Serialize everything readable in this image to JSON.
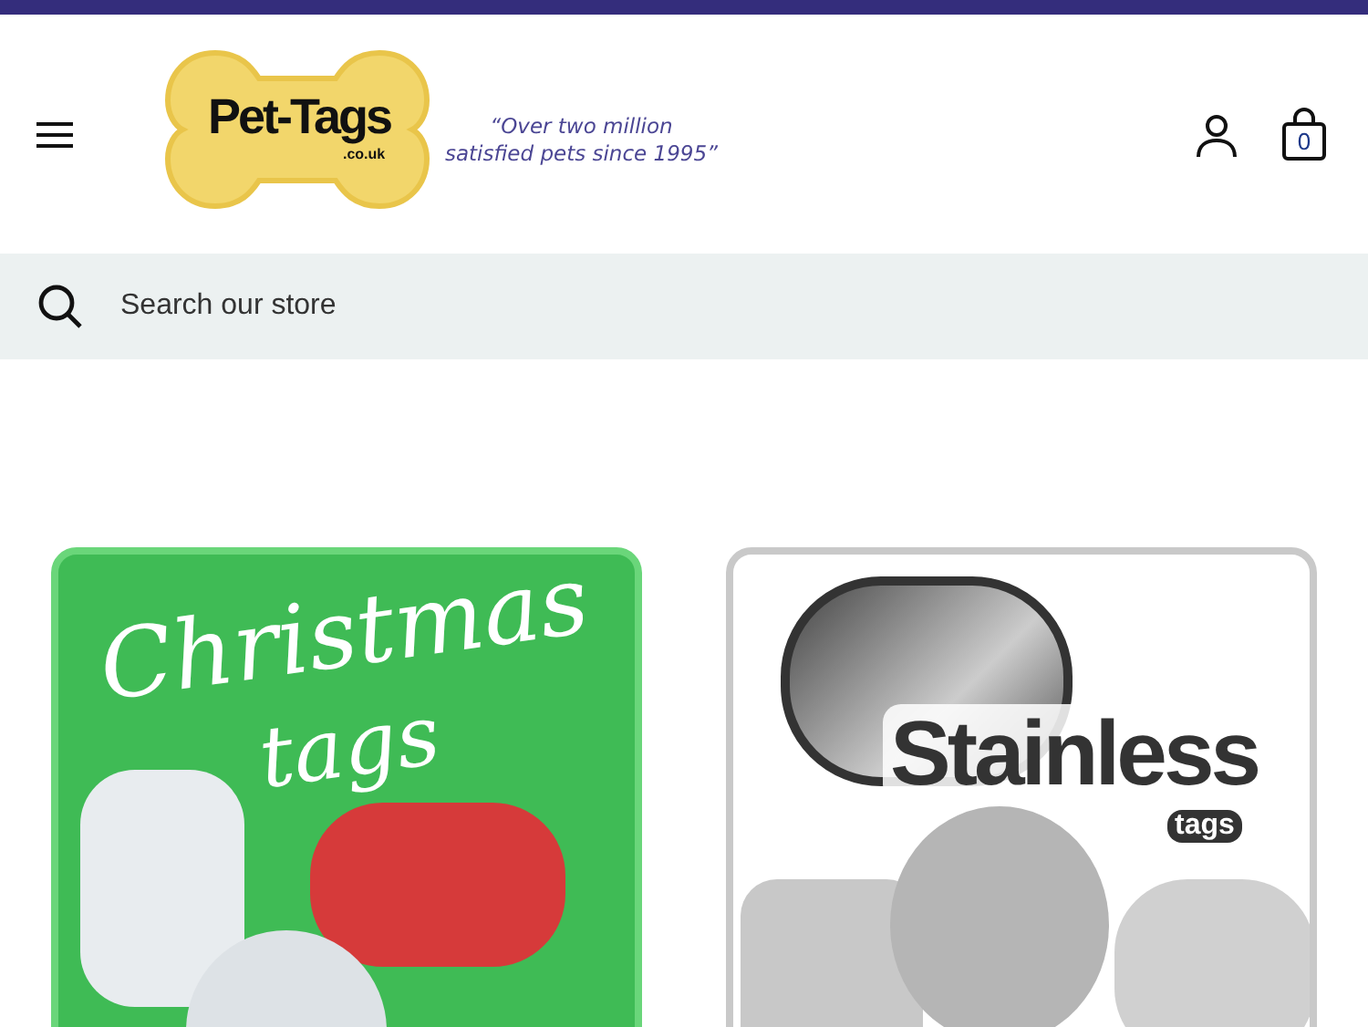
{
  "header": {
    "logo": {
      "name": "Pet-Tags",
      "suffix": ".co.uk"
    },
    "tagline": [
      "“Over two million",
      "satisfied pets since 1995”"
    ],
    "cart_count": "0"
  },
  "search": {
    "placeholder": "Search our store"
  },
  "cards": [
    {
      "kind": "christmas",
      "title": "Christmas",
      "subtitle": "tags"
    },
    {
      "kind": "stainless",
      "title": "Stainless",
      "subtitle": "tags"
    }
  ]
}
